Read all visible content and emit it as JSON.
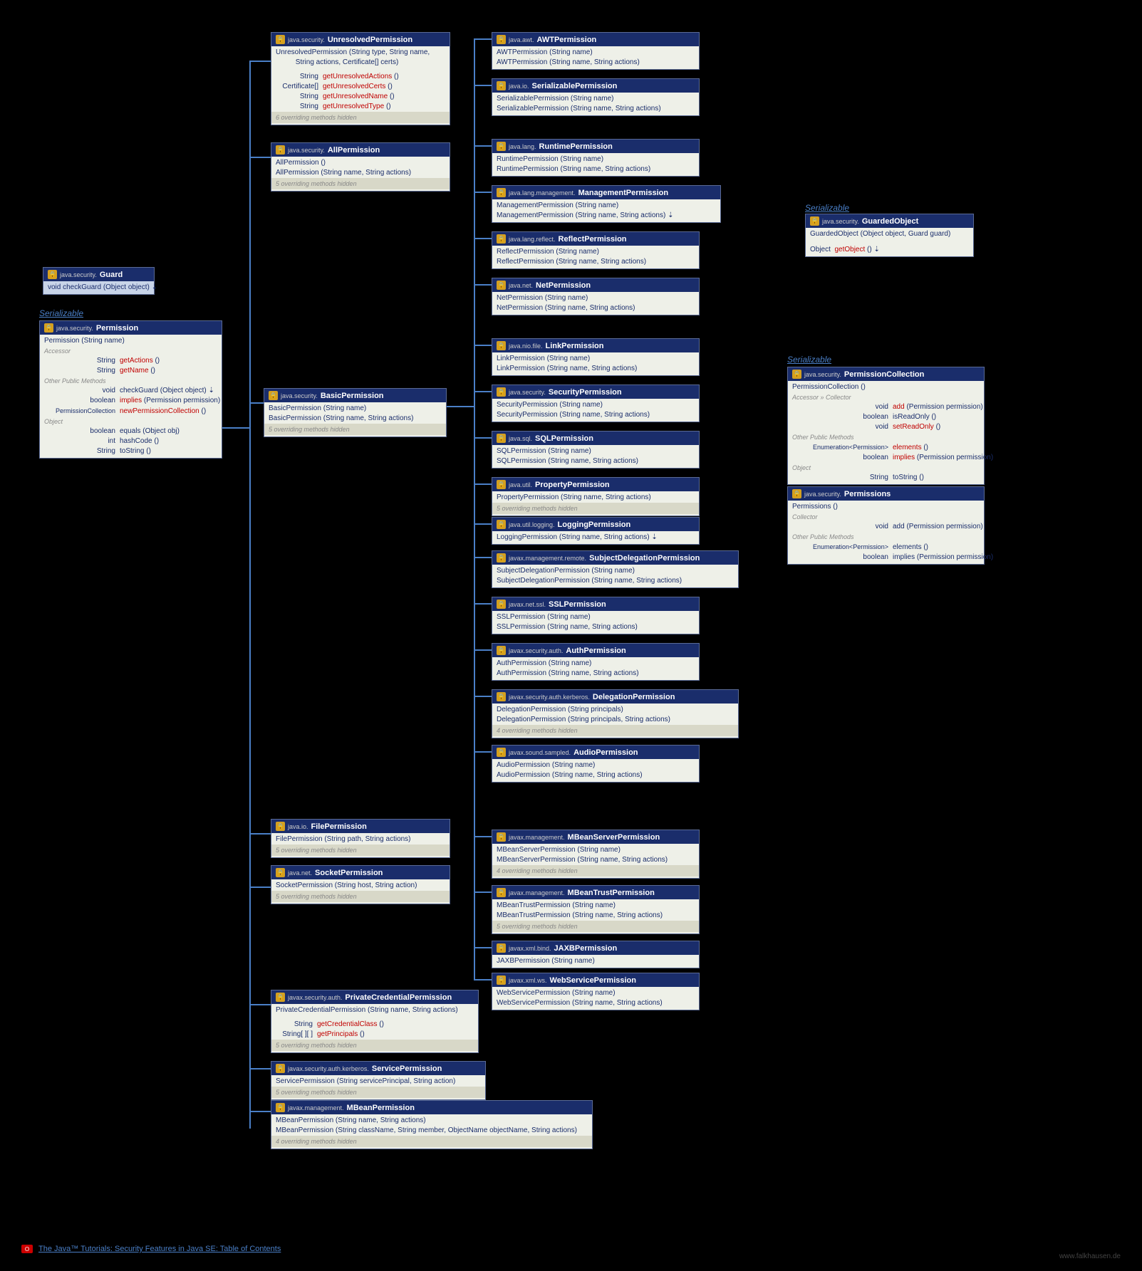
{
  "guard": {
    "pkg": "java.security.",
    "name": "Guard",
    "rows": [
      "void   checkGuard (Object object) ⇣"
    ]
  },
  "permission": {
    "label": "Serializable",
    "pkg": "java.security.",
    "name": "Permission",
    "body": {
      "ctor": "Permission (String name)",
      "accessor": "Accessor",
      "r1": "String   getActions ()",
      "r2": "String   getName ()",
      "other": "Other Public Methods",
      "r3": "void   checkGuard (Object object) ⇣",
      "r4": "boolean   implies (Permission permission)",
      "r5": "PermissionCollection   newPermissionCollection ()",
      "obj": "Object",
      "r6": "boolean   equals (Object obj)",
      "r7": "int   hashCode ()",
      "r8": "String   toString ()"
    }
  },
  "unresolved": {
    "pkg": "java.security.",
    "name": "UnresolvedPermission",
    "ctor": "UnresolvedPermission (String type, String name,\n          String actions, Certificate[] certs)",
    "rows": [
      "String   getUnresolvedActions ()",
      "Certificate[]   getUnresolvedCerts ()",
      "String   getUnresolvedName ()",
      "String   getUnresolvedType ()"
    ],
    "footer": "6 overriding methods hidden"
  },
  "allperm": {
    "pkg": "java.security.",
    "name": "AllPermission",
    "rows": [
      "AllPermission ()",
      "AllPermission (String name, String actions)"
    ],
    "footer": "5 overriding methods hidden"
  },
  "basicperm": {
    "pkg": "java.security.",
    "name": "BasicPermission",
    "rows": [
      "BasicPermission (String name)",
      "BasicPermission (String name, String actions)"
    ],
    "footer": "5 overriding methods hidden"
  },
  "fileperm": {
    "pkg": "java.io.",
    "name": "FilePermission",
    "rows": [
      "FilePermission (String path, String actions)"
    ],
    "footer": "5 overriding methods hidden"
  },
  "socketperm": {
    "pkg": "java.net.",
    "name": "SocketPermission",
    "rows": [
      "SocketPermission (String host, String action)"
    ],
    "footer": "5 overriding methods hidden"
  },
  "privatecred": {
    "pkg": "javax.security.auth.",
    "name": "PrivateCredentialPermission",
    "ctor": "PrivateCredentialPermission (String name, String actions)",
    "rows": [
      "String   getCredentialClass ()",
      "String[ ][ ]   getPrincipals ()"
    ],
    "footer": "5 overriding methods hidden"
  },
  "serviceperm": {
    "pkg": "javax.security.auth.kerberos.",
    "name": "ServicePermission",
    "rows": [
      "ServicePermission (String servicePrincipal, String action)"
    ],
    "footer": "5 overriding methods hidden"
  },
  "mbeanperm": {
    "pkg": "javax.management.",
    "name": "MBeanPermission",
    "rows": [
      "MBeanPermission (String name, String actions)",
      "MBeanPermission (String className, String member, ObjectName objectName, String actions)"
    ],
    "footer": "4 overriding methods hidden"
  },
  "col3": [
    {
      "pkg": "java.awt.",
      "name": "AWTPermission",
      "rows": [
        "AWTPermission (String name)",
        "AWTPermission (String name, String actions)"
      ]
    },
    {
      "pkg": "java.io.",
      "name": "SerializablePermission",
      "rows": [
        "SerializablePermission (String name)",
        "SerializablePermission (String name, String actions)"
      ]
    },
    {
      "pkg": "java.lang.",
      "name": "RuntimePermission",
      "rows": [
        "RuntimePermission (String name)",
        "RuntimePermission (String name, String actions)"
      ]
    },
    {
      "pkg": "java.lang.management.",
      "name": "ManagementPermission",
      "rows": [
        "ManagementPermission (String name)",
        "ManagementPermission (String name, String actions) ⇣"
      ]
    },
    {
      "pkg": "java.lang.reflect.",
      "name": "ReflectPermission",
      "rows": [
        "ReflectPermission (String name)",
        "ReflectPermission (String name, String actions)"
      ]
    },
    {
      "pkg": "java.net.",
      "name": "NetPermission",
      "rows": [
        "NetPermission (String name)",
        "NetPermission (String name, String actions)"
      ]
    },
    {
      "pkg": "java.nio.file.",
      "name": "LinkPermission",
      "rows": [
        "LinkPermission (String name)",
        "LinkPermission (String name, String actions)"
      ]
    },
    {
      "pkg": "java.security.",
      "name": "SecurityPermission",
      "rows": [
        "SecurityPermission (String name)",
        "SecurityPermission (String name, String actions)"
      ]
    },
    {
      "pkg": "java.sql.",
      "name": "SQLPermission",
      "rows": [
        "SQLPermission (String name)",
        "SQLPermission (String name, String actions)"
      ]
    },
    {
      "pkg": "java.util.",
      "name": "PropertyPermission",
      "rows": [
        "PropertyPermission (String name, String actions)"
      ],
      "footer": "5 overriding methods hidden"
    },
    {
      "pkg": "java.util.logging.",
      "name": "LoggingPermission",
      "rows": [
        "LoggingPermission (String name, String actions) ⇣"
      ]
    },
    {
      "pkg": "javax.management.remote.",
      "name": "SubjectDelegationPermission",
      "rows": [
        "SubjectDelegationPermission (String name)",
        "SubjectDelegationPermission (String name, String actions)"
      ]
    },
    {
      "pkg": "javax.net.ssl.",
      "name": "SSLPermission",
      "rows": [
        "SSLPermission (String name)",
        "SSLPermission (String name, String actions)"
      ]
    },
    {
      "pkg": "javax.security.auth.",
      "name": "AuthPermission",
      "rows": [
        "AuthPermission (String name)",
        "AuthPermission (String name, String actions)"
      ]
    },
    {
      "pkg": "javax.security.auth.kerberos.",
      "name": "DelegationPermission",
      "rows": [
        "DelegationPermission (String principals)",
        "DelegationPermission (String principals, String actions)"
      ],
      "footer": "4 overriding methods hidden"
    },
    {
      "pkg": "javax.sound.sampled.",
      "name": "AudioPermission",
      "rows": [
        "AudioPermission (String name)",
        "AudioPermission (String name, String actions)"
      ]
    },
    {
      "pkg": "javax.management.",
      "name": "MBeanServerPermission",
      "rows": [
        "MBeanServerPermission (String name)",
        "MBeanServerPermission (String name, String actions)"
      ],
      "footer": "4 overriding methods hidden"
    },
    {
      "pkg": "javax.management.",
      "name": "MBeanTrustPermission",
      "rows": [
        "MBeanTrustPermission (String name)",
        "MBeanTrustPermission (String name, String actions)"
      ],
      "footer": "5 overriding methods hidden"
    },
    {
      "pkg": "javax.xml.bind.",
      "name": "JAXBPermission",
      "rows": [
        "JAXBPermission (String name)"
      ]
    },
    {
      "pkg": "javax.xml.ws.",
      "name": "WebServicePermission",
      "rows": [
        "WebServicePermission (String name)",
        "WebServicePermission (String name, String actions)"
      ]
    }
  ],
  "guardedobj": {
    "label": "Serializable",
    "pkg": "java.security.",
    "name": "GuardedObject",
    "ctor": "GuardedObject (Object object, Guard guard)",
    "r1": "Object   getObject () ⇣"
  },
  "permcoll": {
    "label": "Serializable",
    "pkg": "java.security.",
    "name": "PermissionCollection",
    "ctor": "PermissionCollection ()",
    "accessor": "Accessor » Collector",
    "r1": "void   add (Permission permission)",
    "r2": "boolean   isReadOnly ()",
    "r3": "void   setReadOnly ()",
    "other": "Other Public Methods",
    "r4": "Enumeration<Permission>   elements ()",
    "r5": "boolean   implies (Permission permission)",
    "obj": "Object",
    "r6": "String   toString ()"
  },
  "permissions": {
    "pkg": "java.security.",
    "name": "Permissions",
    "ctor": "Permissions ()",
    "collector": "Collector",
    "r1": "void   add (Permission permission)",
    "other": "Other Public Methods",
    "r2": "Enumeration<Permission>   elements ()",
    "r3": "boolean   implies (Permission permission)"
  },
  "footer": {
    "link": "The Java™ Tutorials: Security Features in Java SE: Table of Contents",
    "watermark": "www.falkhausen.de"
  }
}
